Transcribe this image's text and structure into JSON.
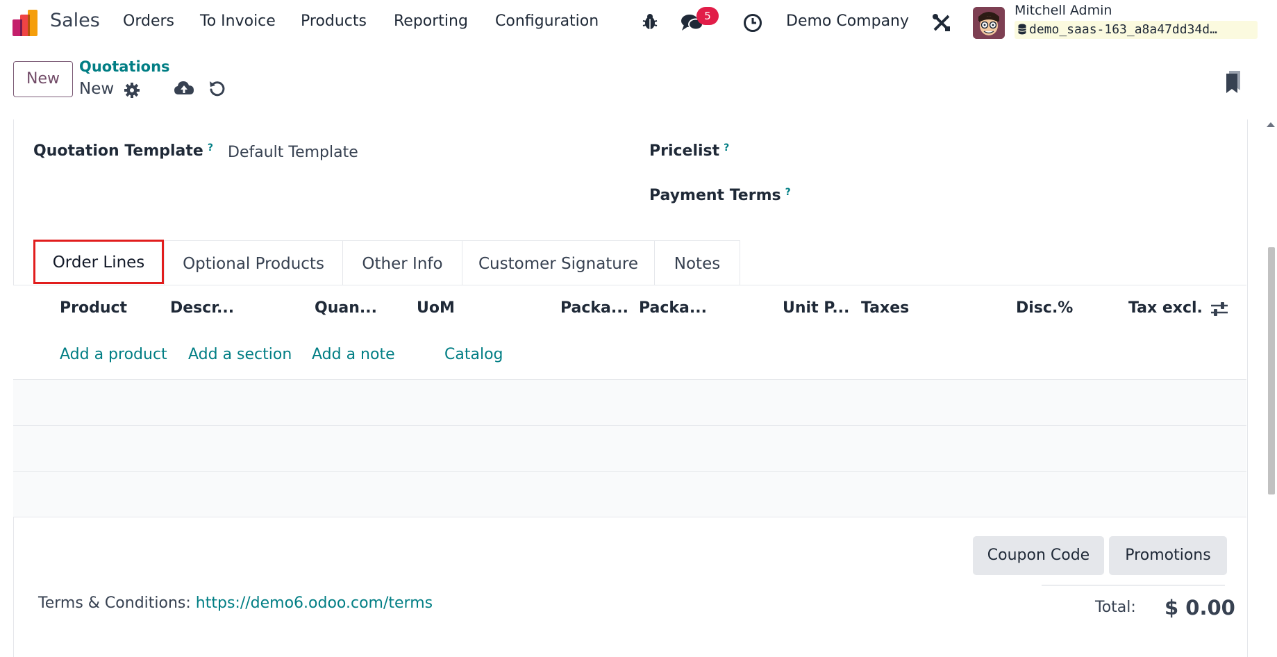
{
  "navbar": {
    "app_name": "Sales",
    "menu": [
      "Orders",
      "To Invoice",
      "Products",
      "Reporting",
      "Configuration"
    ],
    "message_count": "5",
    "company": "Demo Company",
    "user_name": "Mitchell Admin",
    "database": "demo_saas-163_a8a47dd34d…"
  },
  "control_panel": {
    "new_label": "New",
    "breadcrumb_parent": "Quotations",
    "breadcrumb_current": "New"
  },
  "form": {
    "quotation_template_label": "Quotation Template",
    "quotation_template_value": "Default Template",
    "pricelist_label": "Pricelist",
    "payment_terms_label": "Payment Terms",
    "help_mark": "?"
  },
  "tabs": [
    "Order Lines",
    "Optional Products",
    "Other Info",
    "Customer Signature",
    "Notes"
  ],
  "table": {
    "columns": [
      "Product",
      "Descr...",
      "Quan...",
      "UoM",
      "Packa...",
      "Packa...",
      "Unit P...",
      "Taxes",
      "Disc.%",
      "Tax excl."
    ],
    "add_links": [
      "Add a product",
      "Add a section",
      "Add a note",
      "Catalog"
    ]
  },
  "footer": {
    "coupon_label": "Coupon Code",
    "promotions_label": "Promotions",
    "terms_label": "Terms & Conditions: ",
    "terms_url": "https://demo6.odoo.com/terms",
    "total_label": "Total:",
    "total_value": "$ 0.00"
  },
  "colors": {
    "brand_purple": "#714b67",
    "link_teal": "#017e84",
    "highlight_red": "#e11d1d",
    "badge_red": "#e11d48"
  }
}
